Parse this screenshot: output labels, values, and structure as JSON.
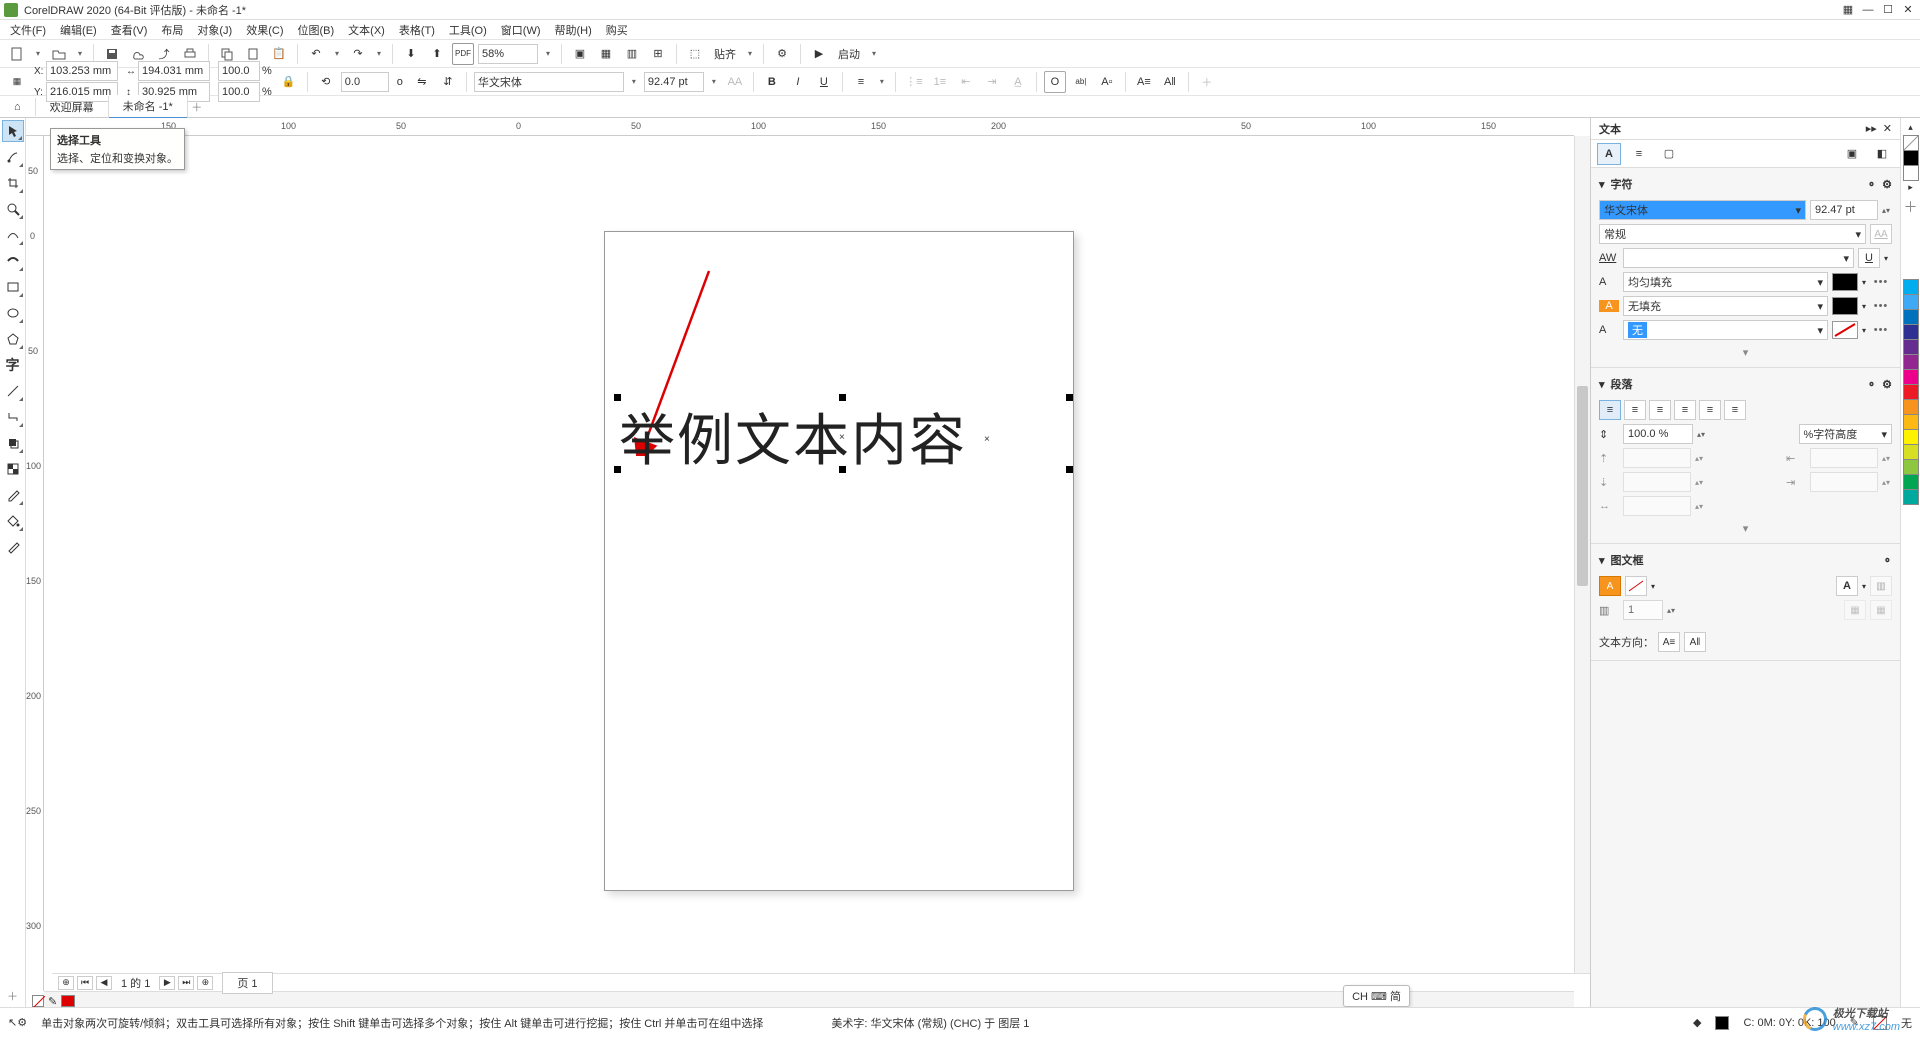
{
  "app": {
    "title": "CorelDRAW 2020 (64-Bit 评估版) - 未命名 -1*"
  },
  "menu": [
    "文件(F)",
    "编辑(E)",
    "查看(V)",
    "布局",
    "对象(J)",
    "效果(C)",
    "位图(B)",
    "文本(X)",
    "表格(T)",
    "工具(O)",
    "窗口(W)",
    "帮助(H)",
    "购买"
  ],
  "tb1": {
    "zoom": "58%",
    "snap": "贴齐",
    "launch": "启动"
  },
  "tb2": {
    "x": "103.253 mm",
    "y": "216.015 mm",
    "w": "194.031 mm",
    "h": "30.925 mm",
    "sx": "100.0",
    "sy": "100.0",
    "pct": "%",
    "rot": "0.0",
    "deg": "o",
    "font": "华文宋体",
    "size": "92.47 pt"
  },
  "tabs": {
    "welcome": "欢迎屏幕",
    "doc": "未命名 -1*"
  },
  "tooltip": {
    "t": "选择工具",
    "d": "选择、定位和变换对象。"
  },
  "ruler_h": [
    "0",
    "50",
    "100",
    "150",
    "200"
  ],
  "ruler_h_neg": [
    "50",
    "100",
    "150"
  ],
  "ruler_h_right": [
    "50",
    "100",
    "150"
  ],
  "ruler_v": [
    "0",
    "50",
    "100",
    "150",
    "200",
    "250",
    "300"
  ],
  "text_content": "举例文本内容",
  "pagenav": {
    "range": "1 的 1",
    "page": "页 1"
  },
  "docker": {
    "title": "文本",
    "sec_char": "字符",
    "font": "华文宋体",
    "size": "92.47 pt",
    "style": "常规",
    "fill_label": "均匀填充",
    "nofill": "无填充",
    "outline_none": "无",
    "sec_para": "段落",
    "spacing": "100.0 %",
    "height_mode": "%字符高度",
    "sec_frame": "图文框",
    "columns": "1",
    "textdir": "文本方向："
  },
  "palette": [
    "#ffffff",
    "#000000",
    "#1a3a6e",
    "#2e5aa8",
    "#3a7ab8",
    "#00aeef",
    "#00a99d",
    "#00a651",
    "#8dc63f",
    "#fff200",
    "#fdb913",
    "#f7941e",
    "#ed1c24",
    "#ec008c",
    "#92278f",
    "#662d91"
  ],
  "status": {
    "hint": "单击对象两次可旋转/倾斜；双击工具可选择所有对象；按住 Shift 键单击可选择多个对象；按住 Alt 键单击可进行挖掘；按住 Ctrl 并单击可在组中选择",
    "art": "美术字: 华文宋体 (常规) (CHC) 于 图层 1",
    "mem": "C:  0M:  0Y:  0K: 100",
    "lang": "CH ⌨ 简"
  },
  "watermark": {
    "t1": "极光下载站",
    "t2": "www.xz7.com"
  }
}
